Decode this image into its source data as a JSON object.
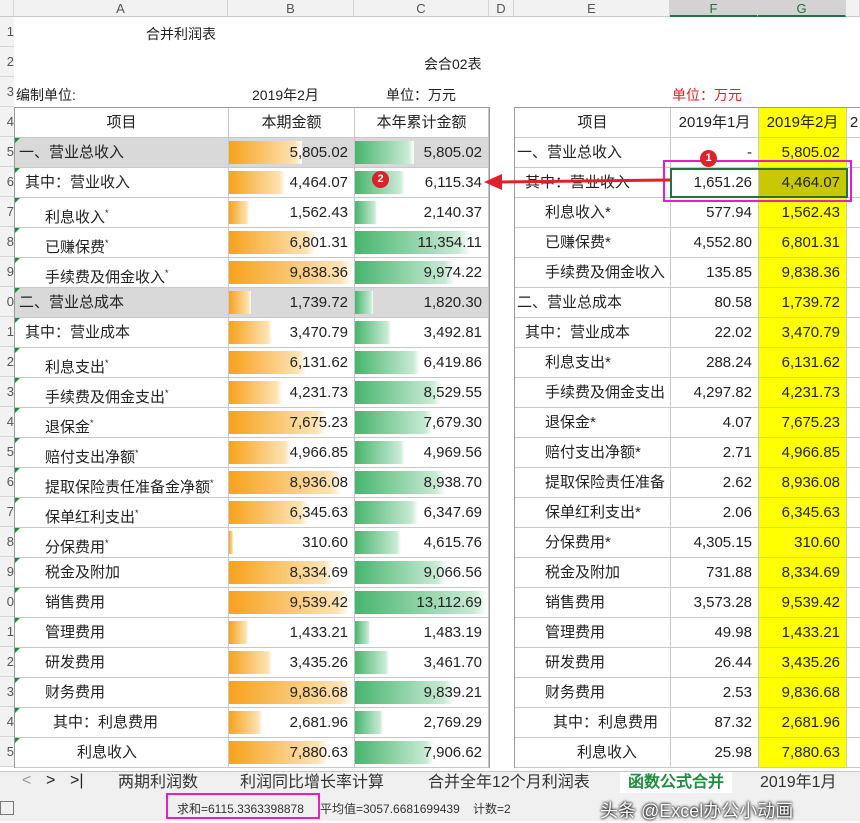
{
  "columns": [
    "A",
    "B",
    "C",
    "D",
    "E",
    "F",
    "G"
  ],
  "row_numbers": [
    "1",
    "2",
    "3",
    "4",
    "5",
    "6",
    "7",
    "8",
    "9",
    "0",
    "1",
    "2",
    "3",
    "4",
    "5",
    "6",
    "7",
    "8",
    "9",
    "0",
    "1",
    "2",
    "3",
    "4",
    "5"
  ],
  "report": {
    "title": "合并利润表",
    "form_no": "会合02表",
    "unit_label": "编制单位:",
    "period": "2019年2月",
    "currency": "单位：万元",
    "right_currency": "单位：万元"
  },
  "left_table": {
    "headers": [
      "项目",
      "本期金额",
      "本年累计金额"
    ],
    "rows": [
      {
        "label": "一、营业总收入",
        "cur": "5,805.02",
        "ytd": "5,805.02",
        "cur_ratio": 0.59,
        "ytd_ratio": 0.45,
        "gray": true
      },
      {
        "label": "其中：营业收入",
        "cur": "4,464.07",
        "ytd": "6,115.34",
        "cur_ratio": 0.45,
        "ytd_ratio": 0.38
      },
      {
        "label": "利息收入",
        "sup": "*",
        "cur": "1,562.43",
        "ytd": "2,140.37",
        "cur_ratio": 0.16,
        "ytd_ratio": 0.17
      },
      {
        "label": "已赚保费",
        "sup": "*",
        "cur": "6,801.31",
        "ytd": "11,354.11",
        "cur_ratio": 0.69,
        "ytd_ratio": 0.87
      },
      {
        "label": "手续费及佣金收入",
        "sup": "*",
        "cur": "9,838.36",
        "ytd": "9,974.22",
        "cur_ratio": 1.0,
        "ytd_ratio": 0.76
      },
      {
        "label": "二、营业总成本",
        "cur": "1,739.72",
        "ytd": "1,820.30",
        "cur_ratio": 0.18,
        "ytd_ratio": 0.14,
        "gray": true
      },
      {
        "label": "其中：营业成本",
        "cur": "3,470.79",
        "ytd": "3,492.81",
        "cur_ratio": 0.35,
        "ytd_ratio": 0.27
      },
      {
        "label": "利息支出",
        "sup": "*",
        "cur": "6,131.62",
        "ytd": "6,419.86",
        "cur_ratio": 0.62,
        "ytd_ratio": 0.49
      },
      {
        "label": "手续费及佣金支出",
        "sup": "*",
        "cur": "4,231.73",
        "ytd": "8,529.55",
        "cur_ratio": 0.43,
        "ytd_ratio": 0.65
      },
      {
        "label": "退保金",
        "sup": "*",
        "cur": "7,675.23",
        "ytd": "7,679.30",
        "cur_ratio": 0.78,
        "ytd_ratio": 0.59
      },
      {
        "label": "赔付支出净额",
        "sup": "*",
        "cur": "4,966.85",
        "ytd": "4,969.56",
        "cur_ratio": 0.5,
        "ytd_ratio": 0.38
      },
      {
        "label": "提取保险责任准备金净额",
        "sup": "*",
        "cur": "8,936.08",
        "ytd": "8,938.70",
        "cur_ratio": 0.91,
        "ytd_ratio": 0.68
      },
      {
        "label": "保单红利支出",
        "sup": "*",
        "cur": "6,345.63",
        "ytd": "6,347.69",
        "cur_ratio": 0.64,
        "ytd_ratio": 0.48
      },
      {
        "label": "分保费用",
        "sup": "*",
        "cur": "310.60",
        "ytd": "4,615.76",
        "cur_ratio": 0.03,
        "ytd_ratio": 0.35
      },
      {
        "label": "税金及附加",
        "cur": "8,334.69",
        "ytd": "9,066.56",
        "cur_ratio": 0.85,
        "ytd_ratio": 0.69
      },
      {
        "label": "销售费用",
        "cur": "9,539.42",
        "ytd": "13,112.69",
        "cur_ratio": 0.97,
        "ytd_ratio": 1.0
      },
      {
        "label": "管理费用",
        "cur": "1,433.21",
        "ytd": "1,483.19",
        "cur_ratio": 0.15,
        "ytd_ratio": 0.11
      },
      {
        "label": "研发费用",
        "cur": "3,435.26",
        "ytd": "3,461.70",
        "cur_ratio": 0.35,
        "ytd_ratio": 0.26
      },
      {
        "label": "财务费用",
        "cur": "9,836.68",
        "ytd": "9,839.21",
        "cur_ratio": 1.0,
        "ytd_ratio": 0.75
      },
      {
        "label": "其中：利息费用",
        "cur": "2,681.96",
        "ytd": "2,769.29",
        "cur_ratio": 0.27,
        "ytd_ratio": 0.21
      },
      {
        "label": "利息收入",
        "cur": "7,880.63",
        "ytd": "7,906.62",
        "cur_ratio": 0.8,
        "ytd_ratio": 0.6
      }
    ]
  },
  "right_table": {
    "headers": [
      "项目",
      "2019年1月",
      "2019年2月",
      "2"
    ],
    "rows": [
      {
        "label": "一、营业总收入",
        "jan": "-",
        "feb": "5,805.02"
      },
      {
        "label": "其中：营业收入",
        "jan": "1,651.26",
        "feb": "4,464.07"
      },
      {
        "label": "利息收入*",
        "jan": "577.94",
        "feb": "1,562.43"
      },
      {
        "label": "已赚保费*",
        "jan": "4,552.80",
        "feb": "6,801.31"
      },
      {
        "label": "手续费及佣金收入",
        "jan": "135.85",
        "feb": "9,838.36"
      },
      {
        "label": "二、营业总成本",
        "jan": "80.58",
        "feb": "1,739.72"
      },
      {
        "label": "其中：营业成本",
        "jan": "22.02",
        "feb": "3,470.79"
      },
      {
        "label": "利息支出*",
        "jan": "288.24",
        "feb": "6,131.62"
      },
      {
        "label": "手续费及佣金支出",
        "jan": "4,297.82",
        "feb": "4,231.73"
      },
      {
        "label": "退保金*",
        "jan": "4.07",
        "feb": "7,675.23"
      },
      {
        "label": "赔付支出净额*",
        "jan": "2.71",
        "feb": "4,966.85"
      },
      {
        "label": "提取保险责任准备",
        "jan": "2.62",
        "feb": "8,936.08"
      },
      {
        "label": "保单红利支出*",
        "jan": "2.06",
        "feb": "6,345.63"
      },
      {
        "label": "分保费用*",
        "jan": "4,305.15",
        "feb": "310.60"
      },
      {
        "label": "税金及附加",
        "jan": "731.88",
        "feb": "8,334.69"
      },
      {
        "label": "销售费用",
        "jan": "3,573.28",
        "feb": "9,539.42"
      },
      {
        "label": "管理费用",
        "jan": "49.98",
        "feb": "1,433.21"
      },
      {
        "label": "研发费用",
        "jan": "26.44",
        "feb": "3,435.26"
      },
      {
        "label": "财务费用",
        "jan": "2.53",
        "feb": "9,836.68"
      },
      {
        "label": "其中：利息费用",
        "jan": "87.32",
        "feb": "2,681.96"
      },
      {
        "label": "利息收入",
        "jan": "25.98",
        "feb": "7,880.63"
      }
    ]
  },
  "annotations": {
    "badge1": "1",
    "badge2": "2"
  },
  "sheet_tabs": [
    "两期利润数",
    "利润同比增长率计算",
    "合并全年12个月利润表",
    "函数公式合并",
    "2019年1月"
  ],
  "status": {
    "sum": "求和=6115.3363398878",
    "avg": "平均值=3057.6681699439",
    "count": "计数=2",
    "watermark": "头条 @Excel办公小动画"
  },
  "colors": {
    "accent": "#217346",
    "highlight": "#e51ec8",
    "yellow": "#ffff00",
    "orange_bar": "#f7a21b",
    "green_bar": "#47b56d",
    "red": "#e0202a"
  }
}
